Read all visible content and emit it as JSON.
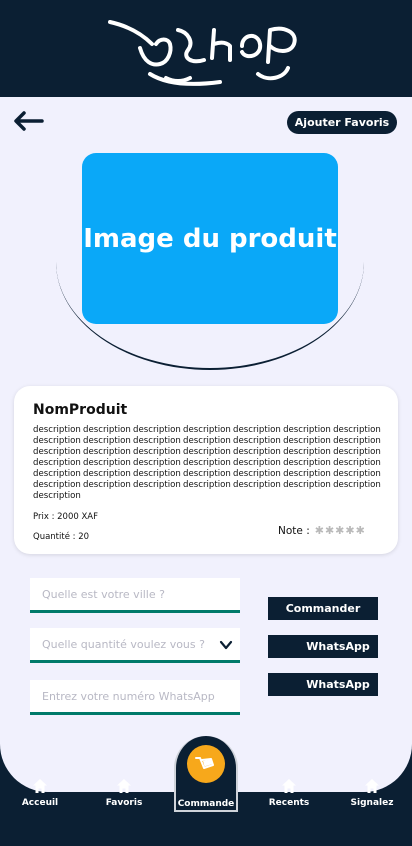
{
  "header": {
    "logo_icon": "shop-logo-icon"
  },
  "top": {
    "back_icon": "arrow-left-icon",
    "favorite_button": "Ajouter Favoris"
  },
  "product": {
    "image_placeholder": "Image du produit",
    "name": "NomProduit",
    "description": "description description description description description description description description description description description description description description description description description description description description description description description description description description description description description description description description description description description description description description description description description description description",
    "price": "Prix : 2000 XAF",
    "quantity": "Quantité : 20",
    "rating_label": "Note :",
    "rating_value": 0,
    "rating_max": 5
  },
  "form": {
    "city_placeholder": "Quelle est votre ville ?",
    "quantity_placeholder": "Quelle quantité voulez vous ?",
    "whatsapp_placeholder": "Entrez votre numéro WhatsApp"
  },
  "actions": {
    "order_button": "Commander",
    "whatsapp_button_1": "WhatsApp",
    "whatsapp_button_2": "WhatsApp"
  },
  "nav": {
    "items": [
      {
        "label": "Acceuil",
        "icon": "home-icon"
      },
      {
        "label": "Favoris",
        "icon": "home-icon"
      },
      {
        "label": "Commande",
        "icon": "cart-icon",
        "active": true
      },
      {
        "label": "Recents",
        "icon": "home-icon"
      },
      {
        "label": "Signalez",
        "icon": "home-icon"
      }
    ]
  },
  "colors": {
    "primary": "#0b1f33",
    "background": "#f1f1fd",
    "image_placeholder": "#0aa8f8",
    "accent": "#f7a81b",
    "field_underline": "#007a6a"
  }
}
